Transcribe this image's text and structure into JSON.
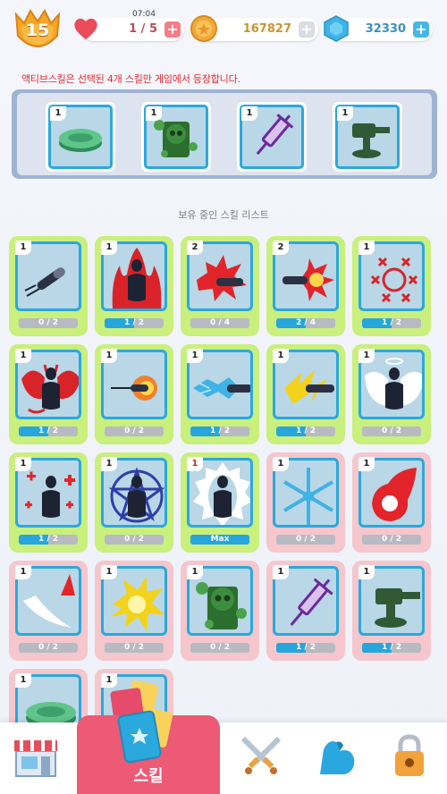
{
  "header": {
    "level": "15",
    "lives_timer": "07:04",
    "lives": "1 / 5",
    "gold": "167827",
    "gems": "32330"
  },
  "notice": "액티브스킬은 선택된 4개 스킬만 게임에서 등장합니다.",
  "active_skills": [
    {
      "level": "1",
      "icon": "green-disc-icon"
    },
    {
      "level": "1",
      "icon": "toxic-skull-icon"
    },
    {
      "level": "1",
      "icon": "syringe-icon"
    },
    {
      "level": "1",
      "icon": "turret-icon"
    }
  ],
  "section_title": "보유 중인 스킬 리스트",
  "skills": [
    {
      "level": "1",
      "icon": "bullet-icon",
      "progress": "0 / 2",
      "fill": 0,
      "owned": true
    },
    {
      "level": "1",
      "icon": "fire-aura-icon",
      "progress": "1 / 2",
      "fill": 0.5,
      "owned": true
    },
    {
      "level": "2",
      "icon": "explosive-bullet-icon",
      "progress": "0 / 4",
      "fill": 0,
      "owned": true
    },
    {
      "level": "2",
      "icon": "exploding-bullet-icon",
      "progress": "2 / 4",
      "fill": 0.5,
      "owned": true
    },
    {
      "level": "1",
      "icon": "crosshair-spread-icon",
      "progress": "1 / 2",
      "fill": 0.5,
      "owned": true
    },
    {
      "level": "1",
      "icon": "devil-wings-icon",
      "progress": "1 / 2",
      "fill": 0.5,
      "owned": true
    },
    {
      "level": "1",
      "icon": "fire-bullet-icon",
      "progress": "0 / 2",
      "fill": 0,
      "owned": true
    },
    {
      "level": "1",
      "icon": "ice-bullet-icon",
      "progress": "1 / 2",
      "fill": 0.5,
      "owned": true
    },
    {
      "level": "1",
      "icon": "lightning-bullet-icon",
      "progress": "1 / 2",
      "fill": 0.5,
      "owned": true
    },
    {
      "level": "1",
      "icon": "angel-wings-icon",
      "progress": "0 / 2",
      "fill": 0,
      "owned": true
    },
    {
      "level": "1",
      "icon": "health-cross-icon",
      "progress": "1 / 2",
      "fill": 0.5,
      "owned": true
    },
    {
      "level": "1",
      "icon": "pentagram-icon",
      "progress": "0 / 2",
      "fill": 0,
      "owned": true
    },
    {
      "level": "1",
      "icon": "shield-aura-icon",
      "progress": "Max",
      "fill": 1,
      "owned": true,
      "level_red": true
    },
    {
      "level": "1",
      "icon": "snowflake-icon",
      "progress": "0 / 2",
      "fill": 0,
      "owned": false
    },
    {
      "level": "1",
      "icon": "fireball-icon",
      "progress": "0 / 2",
      "fill": 0,
      "owned": false
    },
    {
      "level": "1",
      "icon": "feather-rocket-icon",
      "progress": "0 / 2",
      "fill": 0,
      "owned": false
    },
    {
      "level": "1",
      "icon": "lightning-burst-icon",
      "progress": "0 / 2",
      "fill": 0,
      "owned": false
    },
    {
      "level": "1",
      "icon": "toxic-skull-icon",
      "progress": "0 / 2",
      "fill": 0,
      "owned": false
    },
    {
      "level": "1",
      "icon": "syringe-icon",
      "progress": "1 / 2",
      "fill": 0.5,
      "owned": false
    },
    {
      "level": "1",
      "icon": "turret-icon",
      "progress": "1 / 2",
      "fill": 0.5,
      "owned": false
    },
    {
      "level": "1",
      "icon": "green-disc-icon",
      "progress": "",
      "fill": 0,
      "owned": false
    },
    {
      "level": "1",
      "icon": "cards-icon",
      "progress": "",
      "fill": 0,
      "owned": false
    }
  ],
  "nav": {
    "shop": "shop-icon",
    "skill_label": "스킬",
    "battle": "crossed-swords-icon",
    "upgrade": "flexed-arm-icon",
    "locked": "padlock-icon"
  },
  "colors": {
    "owned_card": "#c9ef7c",
    "locked_card": "#f5c6cc",
    "card_border": "#2ba8dc",
    "nav_active": "#ec5a76",
    "notice": "#e1292f"
  }
}
